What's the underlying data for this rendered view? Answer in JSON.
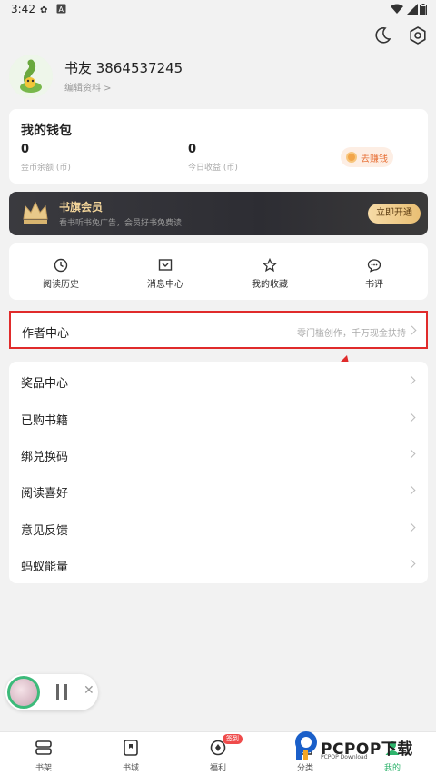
{
  "status_bar": {
    "time": "3:42"
  },
  "profile": {
    "username": "书友 3864537245",
    "edit_label": "编辑资料 >"
  },
  "wallet": {
    "title": "我的钱包",
    "coin_balance": {
      "value": "0",
      "label": "金币余额 (币)"
    },
    "today_income": {
      "value": "0",
      "label": "今日收益 (币)"
    },
    "earn_button": "去赚钱"
  },
  "vip": {
    "title": "书旗会员",
    "subtitle": "看书听书免广告，会员好书免费读",
    "button": "立即开通"
  },
  "shortcuts": [
    {
      "label": "阅读历史",
      "icon": "clock-icon"
    },
    {
      "label": "消息中心",
      "icon": "message-icon"
    },
    {
      "label": "我的收藏",
      "icon": "star-icon"
    },
    {
      "label": "书评",
      "icon": "comment-icon"
    }
  ],
  "author_center": {
    "title": "作者中心",
    "subtitle": "零门槛创作，千万现金扶持"
  },
  "menu": [
    {
      "label": "奖品中心"
    },
    {
      "label": "已购书籍"
    },
    {
      "label": "绑兑换码"
    },
    {
      "label": "阅读喜好"
    },
    {
      "label": "意见反馈"
    },
    {
      "label": "蚂蚁能量"
    }
  ],
  "bottom_nav": [
    {
      "label": "书架",
      "icon": "bookshelf-icon"
    },
    {
      "label": "书城",
      "icon": "bookstore-icon"
    },
    {
      "label": "福利",
      "icon": "welfare-icon",
      "badge": "签到"
    },
    {
      "label": "分类",
      "icon": "category-icon"
    },
    {
      "label": "我的",
      "icon": "profile-icon",
      "active": true
    }
  ],
  "watermark": {
    "brand": "PCPOP下载",
    "sub": "PCPOP Download"
  },
  "colors": {
    "accent": "#2db36b",
    "highlight_border": "#e02b2b",
    "earn": "#e8733a",
    "vip_gold": "#f3d59a"
  }
}
